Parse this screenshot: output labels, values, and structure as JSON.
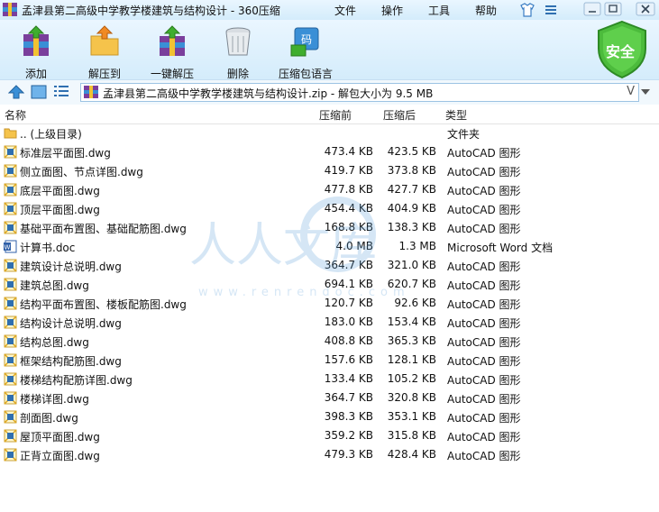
{
  "window": {
    "title": "孟津县第二高级中学教学楼建筑与结构设计 - 360压缩",
    "menu": [
      "文件",
      "操作",
      "工具",
      "帮助"
    ]
  },
  "toolbar": {
    "tools": [
      "添加",
      "解压到",
      "一键解压",
      "删除",
      "压缩包语言"
    ],
    "security": "安全"
  },
  "address": {
    "path": "孟津县第二高级中学教学楼建筑与结构设计.zip - 解包大小为 9.5 MB"
  },
  "columns": [
    "名称",
    "压缩前",
    "压缩后",
    "类型"
  ],
  "files": [
    {
      "name": ".. (上级目录)",
      "before": "",
      "after": "",
      "type": "文件夹",
      "icon": "folder-icon"
    },
    {
      "name": "标准层平面图.dwg",
      "before": "473.4 KB",
      "after": "423.5 KB",
      "type": "AutoCAD 图形",
      "icon": "dwg-file-icon"
    },
    {
      "name": "侧立面图、节点详图.dwg",
      "before": "419.7 KB",
      "after": "373.8 KB",
      "type": "AutoCAD 图形",
      "icon": "dwg-file-icon"
    },
    {
      "name": "底层平面图.dwg",
      "before": "477.8 KB",
      "after": "427.7 KB",
      "type": "AutoCAD 图形",
      "icon": "dwg-file-icon"
    },
    {
      "name": "顶层平面图.dwg",
      "before": "454.4 KB",
      "after": "404.9 KB",
      "type": "AutoCAD 图形",
      "icon": "dwg-file-icon"
    },
    {
      "name": "基础平面布置图、基础配筋图.dwg",
      "before": "168.8 KB",
      "after": "138.3 KB",
      "type": "AutoCAD 图形",
      "icon": "dwg-file-icon"
    },
    {
      "name": "计算书.doc",
      "before": "4.0 MB",
      "after": "1.3 MB",
      "type": "Microsoft Word 文档",
      "icon": "word-file-icon"
    },
    {
      "name": "建筑设计总说明.dwg",
      "before": "364.7 KB",
      "after": "321.0 KB",
      "type": "AutoCAD 图形",
      "icon": "dwg-file-icon"
    },
    {
      "name": "建筑总图.dwg",
      "before": "694.1 KB",
      "after": "620.7 KB",
      "type": "AutoCAD 图形",
      "icon": "dwg-file-icon"
    },
    {
      "name": "结构平面布置图、楼板配筋图.dwg",
      "before": "120.7 KB",
      "after": "92.6 KB",
      "type": "AutoCAD 图形",
      "icon": "dwg-file-icon"
    },
    {
      "name": "结构设计总说明.dwg",
      "before": "183.0 KB",
      "after": "153.4 KB",
      "type": "AutoCAD 图形",
      "icon": "dwg-file-icon"
    },
    {
      "name": "结构总图.dwg",
      "before": "408.8 KB",
      "after": "365.3 KB",
      "type": "AutoCAD 图形",
      "icon": "dwg-file-icon"
    },
    {
      "name": "框架结构配筋图.dwg",
      "before": "157.6 KB",
      "after": "128.1 KB",
      "type": "AutoCAD 图形",
      "icon": "dwg-file-icon"
    },
    {
      "name": "楼梯结构配筋详图.dwg",
      "before": "133.4 KB",
      "after": "105.2 KB",
      "type": "AutoCAD 图形",
      "icon": "dwg-file-icon"
    },
    {
      "name": "楼梯详图.dwg",
      "before": "364.7 KB",
      "after": "320.8 KB",
      "type": "AutoCAD 图形",
      "icon": "dwg-file-icon"
    },
    {
      "name": "剖面图.dwg",
      "before": "398.3 KB",
      "after": "353.1 KB",
      "type": "AutoCAD 图形",
      "icon": "dwg-file-icon"
    },
    {
      "name": "屋顶平面图.dwg",
      "before": "359.2 KB",
      "after": "315.8 KB",
      "type": "AutoCAD 图形",
      "icon": "dwg-file-icon"
    },
    {
      "name": "正背立面图.dwg",
      "before": "479.3 KB",
      "after": "428.4 KB",
      "type": "AutoCAD 图形",
      "icon": "dwg-file-icon"
    }
  ],
  "watermark": {
    "main": "人人文库",
    "url": "www.renrendoc.com"
  },
  "colors": {
    "accent": "#2a7fd4",
    "security_green": "#3aa83a"
  }
}
